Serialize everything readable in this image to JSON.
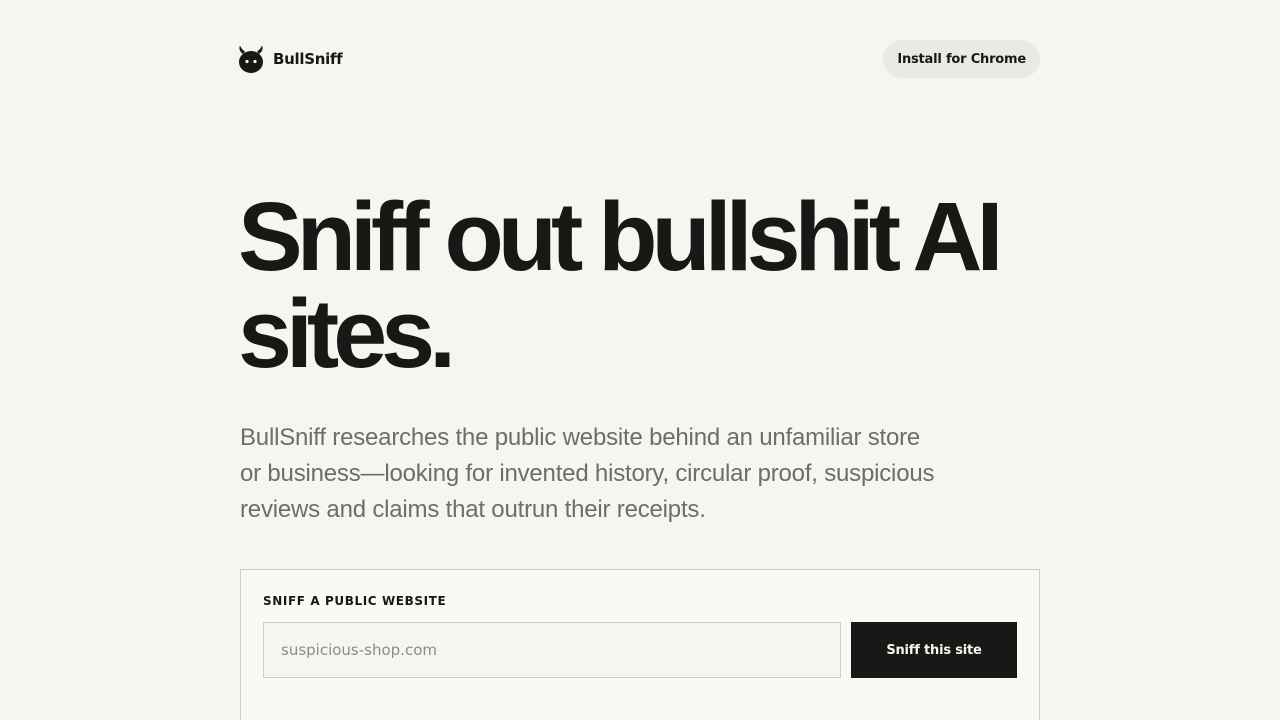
{
  "nav": {
    "brand_name": "BullSniff",
    "logo_icon": "bull-head-icon",
    "install_label": "Install for Chrome"
  },
  "hero": {
    "title_line1": "Sniff out bullshit AI",
    "title_line2": "sites.",
    "description": "BullSniff researches the public website behind an unfamiliar store or business—looking for invented history, circular proof, suspicious reviews and claims that outrun their receipts."
  },
  "sniff_form": {
    "label": "SNIFF A PUBLIC WEBSITE",
    "input_value": "",
    "input_placeholder": "suspicious-shop.com",
    "submit_label": "Sniff this site"
  },
  "colors": {
    "background": "#f6f5f0",
    "text_primary": "#181816",
    "text_muted": "#6f6d68",
    "button_dark": "#181816",
    "pill_bg": "#ebe9e3"
  }
}
